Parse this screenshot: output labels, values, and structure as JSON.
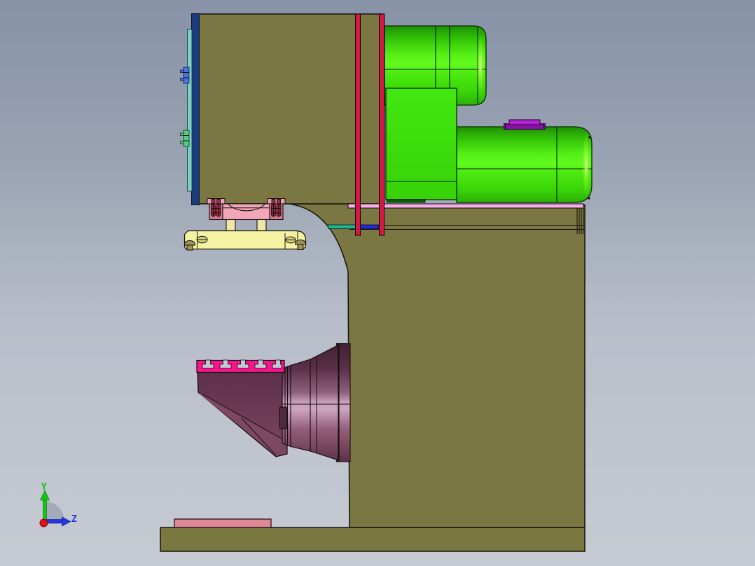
{
  "scene": {
    "type": "cad-3d-viewport",
    "view": "side",
    "t_slot_count": 5
  },
  "axes": {
    "y_label": "Y",
    "z_label": "Z",
    "y_color": "#12c412",
    "z_color": "#2437e4",
    "origin_dot_color": "#e21212"
  },
  "colors": {
    "bg_top": "#8792a7",
    "bg_bottom": "#c6cad3",
    "olive": "#7b7742",
    "olive_base": "#7a7841",
    "navy": "#1d3c7e",
    "teal_strip": "#7ccfc4",
    "clip_blue": "#4f6fe0",
    "clip_green": "#55cc85",
    "red_strip": "#d51843",
    "green_bright": "#54ef15",
    "green_flat": "#3fe20d",
    "shelf_pink": "#f3b0e5",
    "teal_seg": "#1cb694",
    "blue_seg": "#2326dd",
    "cap_purple": "#b322d6",
    "cap_purple_dark": "#8c12ac",
    "ram_pink": "#f2a6ba",
    "bracket_pink": "#d07b8d",
    "cap_pink": "#e8a4b6",
    "screw_red": "#8f3247",
    "post_yellow": "#eee8a6",
    "bar_yellow": "#f4f3a4",
    "bolt_olive": "#9a9456",
    "table_magenta": "#f7148f",
    "plum_mid": "#8f617b",
    "knee_plum": "#6c3b54",
    "plate_pink": "#de8795",
    "axis_green": "#12c412",
    "axis_blue": "#2437e4",
    "axis_red": "#e21212"
  },
  "parts": [
    {
      "id": "frame",
      "label": "c-frame-body",
      "color": "#7b7742"
    },
    {
      "id": "base",
      "label": "base-block",
      "color": "#7a7841"
    },
    {
      "id": "floor-plate",
      "label": "base-plate",
      "color": "#de8795"
    },
    {
      "id": "motor-upper",
      "label": "upper-motor-cylinder",
      "color": "#54ef15"
    },
    {
      "id": "motor-lower",
      "label": "lower-motor-cylinder",
      "color": "#54ef15"
    },
    {
      "id": "gearbox",
      "label": "gear-housing",
      "color": "#3fe20d"
    },
    {
      "id": "terminal-cap",
      "label": "terminal-cap",
      "color": "#b322d6"
    },
    {
      "id": "guide-strips",
      "label": "vertical-guide-strips",
      "color": "#d51843"
    },
    {
      "id": "back-plate",
      "label": "back-plate",
      "color": "#1d3c7e"
    },
    {
      "id": "cover-strip",
      "label": "cover-strip",
      "color": "#7ccfc4"
    },
    {
      "id": "shelf",
      "label": "mounting-shelf",
      "color": "#f3b0e5"
    },
    {
      "id": "ram",
      "label": "ram-slide",
      "color": "#f2a6ba"
    },
    {
      "id": "tool-bar",
      "label": "tool-holder-bar",
      "color": "#f4f3a4"
    },
    {
      "id": "t-slot-table",
      "label": "t-slot-table",
      "color": "#f7148f",
      "slot_count": 5
    },
    {
      "id": "knee",
      "label": "knee-bracket",
      "color": "#6c3b54"
    },
    {
      "id": "spindle-hub",
      "label": "cone-hub",
      "color": "#8f617b"
    }
  ]
}
